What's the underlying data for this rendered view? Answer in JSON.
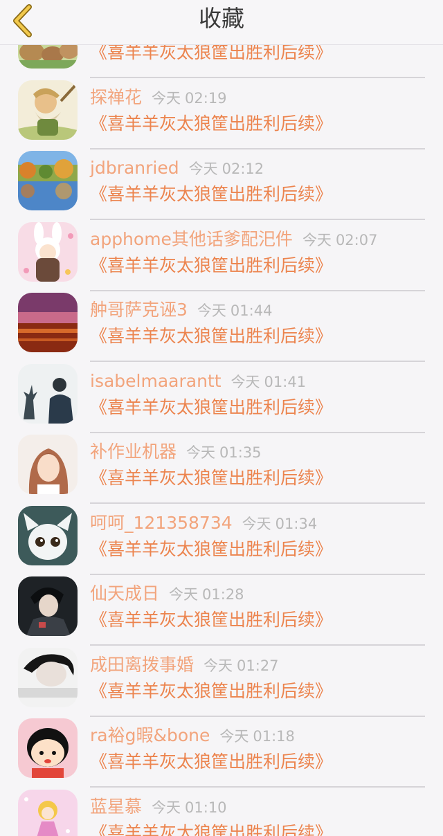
{
  "header": {
    "title": "收藏"
  },
  "items": [
    {
      "name": "",
      "day": "",
      "time": "",
      "title": "《喜羊羊灰太狼筐出胜利后续》"
    },
    {
      "name": "探禅花",
      "day": "今天",
      "time": "02:19",
      "title": "《喜羊羊灰太狼筐出胜利后续》"
    },
    {
      "name": "jdbranried",
      "day": "今天",
      "time": "02:12",
      "title": "《喜羊羊灰太狼筐出胜利后续》"
    },
    {
      "name": "apphome其他话爹配汜件",
      "day": "今天",
      "time": "02:07",
      "title": "《喜羊羊灰太狼筐出胜利后续》"
    },
    {
      "name": "舯哥萨克诬3",
      "day": "今天",
      "time": "01:44",
      "title": "《喜羊羊灰太狼筐出胜利后续》"
    },
    {
      "name": "isabelmaarantt",
      "day": "今天",
      "time": "01:41",
      "title": "《喜羊羊灰太狼筐出胜利后续》"
    },
    {
      "name": "补作业机器",
      "day": "今天",
      "time": "01:35",
      "title": "《喜羊羊灰太狼筐出胜利后续》"
    },
    {
      "name": "呵呵_121358734",
      "day": "今天",
      "time": "01:34",
      "title": "《喜羊羊灰太狼筐出胜利后续》"
    },
    {
      "name": "仙天成日",
      "day": "今天",
      "time": "01:28",
      "title": "《喜羊羊灰太狼筐出胜利后续》"
    },
    {
      "name": "成田离拨事婚",
      "day": "今天",
      "time": "01:27",
      "title": "《喜羊羊灰太狼筐出胜利后续》"
    },
    {
      "name": "ra裕g暇&bone",
      "day": "今天",
      "time": "01:18",
      "title": "《喜羊羊灰太狼筐出胜利后续》"
    },
    {
      "name": "蓝星慕",
      "day": "今天",
      "time": "01:10",
      "title": "《喜羊羊灰太狼筐出胜利后续》"
    }
  ]
}
